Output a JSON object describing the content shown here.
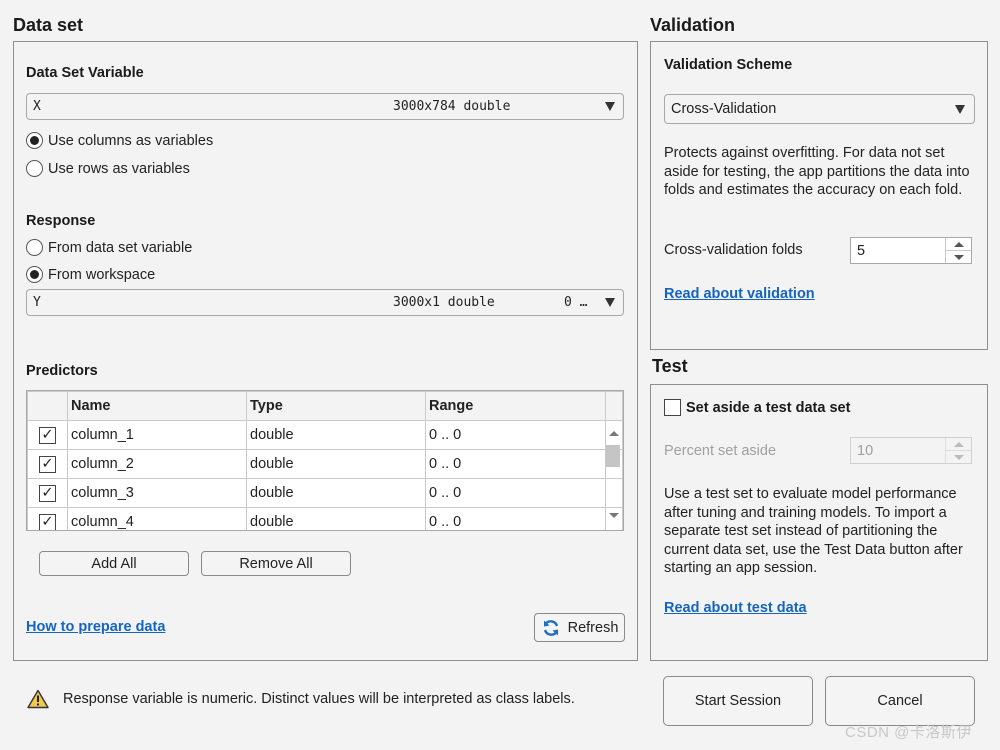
{
  "dataset": {
    "title": "Data set",
    "variable_label": "Data Set Variable",
    "variable_name": "X",
    "variable_desc": "3000x784 double",
    "orientation": [
      {
        "label": "Use columns as variables",
        "selected": true
      },
      {
        "label": "Use rows as variables",
        "selected": false
      }
    ],
    "response_label": "Response",
    "response_options": [
      {
        "label": "From data set variable",
        "selected": false
      },
      {
        "label": "From workspace",
        "selected": true
      }
    ],
    "response_name": "Y",
    "response_desc": "3000x1 double",
    "response_extra": "0 …",
    "predictors_label": "Predictors",
    "columns": [
      "Name",
      "Type",
      "Range"
    ],
    "rows": [
      {
        "name": "column_1",
        "type": "double",
        "range": "0 .. 0",
        "checked": true
      },
      {
        "name": "column_2",
        "type": "double",
        "range": "0 .. 0",
        "checked": true
      },
      {
        "name": "column_3",
        "type": "double",
        "range": "0 .. 0",
        "checked": true
      },
      {
        "name": "column_4",
        "type": "double",
        "range": "0 .. 0",
        "checked": true
      }
    ],
    "add_all": "Add All",
    "remove_all": "Remove All",
    "prepare_link": "How to prepare data",
    "refresh": "Refresh"
  },
  "validation": {
    "title": "Validation",
    "scheme_label": "Validation Scheme",
    "scheme_value": "Cross-Validation",
    "description": "Protects against overfitting. For data not set aside for testing, the app partitions the data into folds and estimates the accuracy on each fold.",
    "folds_label": "Cross-validation folds",
    "folds_value": "5",
    "link": "Read about validation"
  },
  "test": {
    "title": "Test",
    "checkbox_label": "Set aside a test data set",
    "checked": false,
    "percent_label": "Percent set aside",
    "percent_value": "10",
    "description": "Use a test set to evaluate model performance after tuning and training models. To import a separate test set instead of partitioning the current data set, use the Test Data button after starting an app session.",
    "link": "Read about test data"
  },
  "footer": {
    "warning": "Response variable is numeric. Distinct values will be interpreted as class labels.",
    "start": "Start Session",
    "cancel": "Cancel",
    "watermark": "CSDN @卡洛斯伊"
  },
  "colors": {
    "link": "#1565c0",
    "warning": "#f2c94c"
  },
  "icons": {
    "warning": "warning-icon",
    "refresh": "refresh-icon",
    "dropdown": "chevron-down-icon"
  }
}
